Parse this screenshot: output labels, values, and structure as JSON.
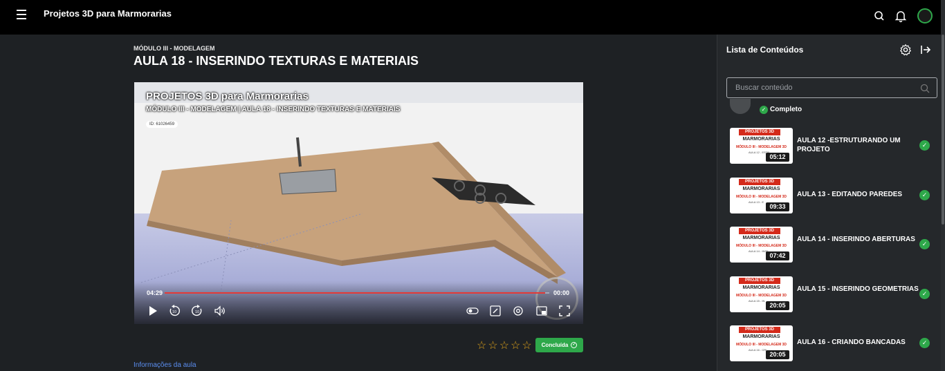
{
  "header": {
    "app_title": "Projetos 3D para Marmorarias"
  },
  "lesson": {
    "module": "MÓDULO III - MODELAGEM",
    "title": "AULA 18 - INSERINDO TEXTURAS E MATERIAIS",
    "info_link": "Informações da aula",
    "done_label": "Concluída",
    "rating": "0"
  },
  "player": {
    "overlay_title": "PROJETOS 3D para Marmorarias",
    "overlay_subtitle": "MÓDULO III - MODELAGEM | AULA 18 - INSERINDO TEXTURAS E MATERIAIS",
    "overlay_id": "ID: 61026459",
    "time_elapsed": "04:29",
    "time_remaining": "00:00",
    "progress": 0.99,
    "skip_back": "10",
    "skip_forward": "10"
  },
  "panel": {
    "title": "Lista de Conteúdos",
    "search_placeholder": "Buscar conteúdo",
    "complete_label": "Completo",
    "items": [
      {
        "title": "AULA 12 -ESTRUTURANDO UM PROJETO",
        "duration": "05:12",
        "thumb_brand": "PROJETOS 3D",
        "thumb_name": "MARMORARIAS",
        "thumb_module": "MÓDULO III - MODELAGEM 3D",
        "thumb_small": "AULA 12 - ESTR",
        "completed": "true"
      },
      {
        "title": "AULA 13 - EDITANDO PAREDES",
        "duration": "09:33",
        "thumb_brand": "PROJETOS 3D",
        "thumb_name": "MARMORARIAS",
        "thumb_module": "MÓDULO III - MODELAGEM 3D",
        "thumb_small": "AULA 13 - E",
        "completed": "true"
      },
      {
        "title": "AULA 14 - INSERINDO ABERTURAS",
        "duration": "07:42",
        "thumb_brand": "PROJETOS 3D",
        "thumb_name": "MARMORARIAS",
        "thumb_module": "MÓDULO III - MODELAGEM 3D",
        "thumb_small": "AULA 14 - INSE",
        "completed": "true"
      },
      {
        "title": "AULA 15 - INSERINDO GEOMETRIAS",
        "duration": "20:05",
        "thumb_brand": "PROJETOS 3D",
        "thumb_name": "MARMORARIAS",
        "thumb_module": "MÓDULO III - MODELAGEM 3D",
        "thumb_small": "AULA 15 - IN",
        "completed": "true"
      },
      {
        "title": "AULA 16 - CRIANDO BANCADAS",
        "duration": "20:05",
        "thumb_brand": "PROJETOS 3D",
        "thumb_name": "MARMORARIAS",
        "thumb_module": "MÓDULO III - MODELAGEM 3D",
        "thumb_small": "AULA 16 - CRI",
        "completed": "true"
      }
    ]
  },
  "colors": {
    "accent_green": "#2ea84a",
    "link_blue": "#5b8ef0",
    "star_gold": "#e0a31a",
    "progress_red": "#e53935"
  }
}
